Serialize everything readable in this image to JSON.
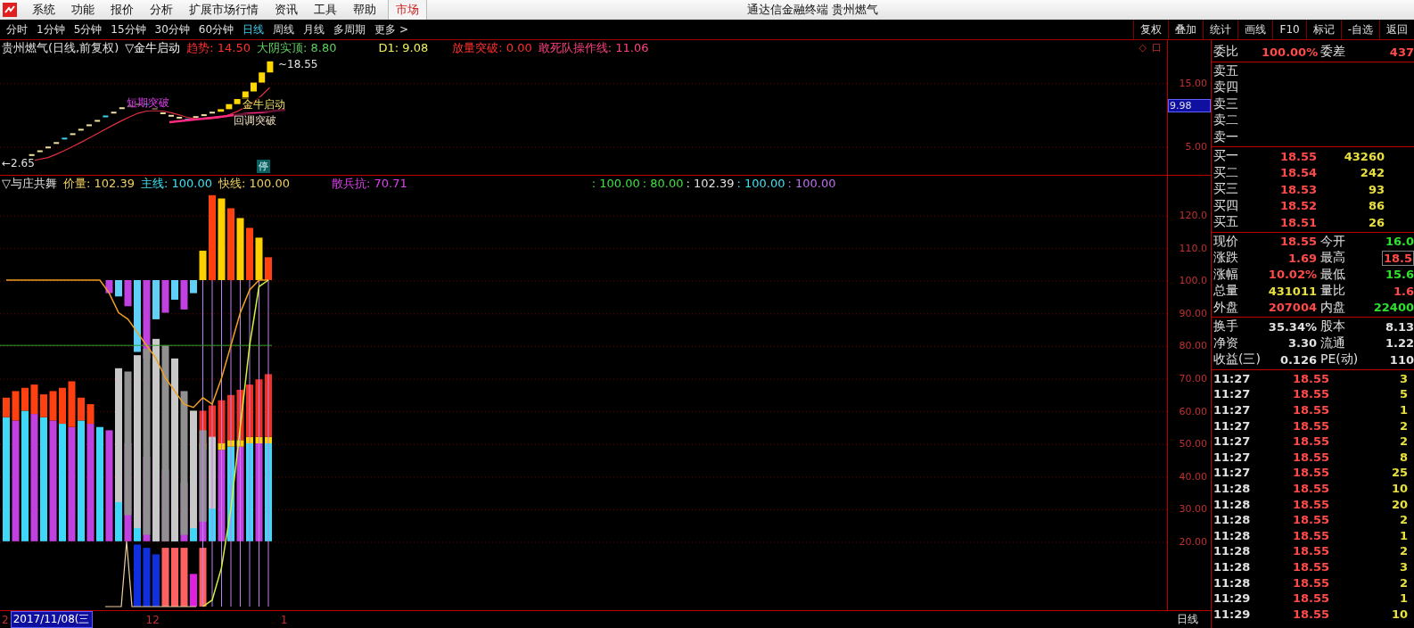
{
  "menu_bar": {
    "items": [
      "系统",
      "功能",
      "报价",
      "分析",
      "扩展市场行情",
      "资讯",
      "工具",
      "帮助"
    ],
    "market_tab": "市场",
    "title": "通达信金融终端 贵州燃气"
  },
  "period_tabs": [
    {
      "label": "分时",
      "selected": false
    },
    {
      "label": "1分钟",
      "selected": false
    },
    {
      "label": "5分钟",
      "selected": false
    },
    {
      "label": "15分钟",
      "selected": false
    },
    {
      "label": "30分钟",
      "selected": false
    },
    {
      "label": "60分钟",
      "selected": false
    },
    {
      "label": "日线",
      "selected": true
    },
    {
      "label": "周线",
      "selected": false
    },
    {
      "label": "月线",
      "selected": false
    },
    {
      "label": "多周期",
      "selected": false
    },
    {
      "label": "更多 >",
      "selected": false
    }
  ],
  "tool_buttons": [
    "复权",
    "叠加",
    "统计",
    "画线",
    "F10",
    "标记",
    "-自选",
    "返回"
  ],
  "price_panel": {
    "header": [
      {
        "text": "贵州燃气(日线,前复权)",
        "color": "#e0e0e0"
      },
      {
        "text": "▽金牛启动",
        "color": "#f4f4f4"
      },
      {
        "text": "趋势: 14.50",
        "color": "#ff3030"
      },
      {
        "text": "大阴实顶: 8.80",
        "color": "#60d060"
      },
      {
        "text": "D1: 9.08",
        "color": "#f0f060"
      },
      {
        "text": "放量突破: 0.00",
        "color": "#ff3030"
      },
      {
        "text": "敢死队操作线: 11.06",
        "color": "#ff4080"
      }
    ],
    "corner_icons": [
      "◇",
      "口"
    ],
    "high_label": "~18.55",
    "low_label": "←2.65",
    "annotations": [
      "短期突破",
      "金牛启动",
      "回调突破"
    ],
    "limit_badge": "停",
    "axis_ticks": [
      "15.00",
      "5.00"
    ],
    "current_tag": "9.98"
  },
  "indicator_panel": {
    "header": [
      {
        "text": "▽与庄共舞",
        "color": "#e0e0e0"
      },
      {
        "text": "价量: 102.39",
        "color": "#f0d060"
      },
      {
        "text": "主线: 100.00",
        "color": "#40e0f0"
      },
      {
        "text": "快线: 100.00",
        "color": "#f0d060"
      },
      {
        "text": "散兵抗: 70.71",
        "color": "#e040f0"
      },
      {
        "text": ": 100.00",
        "color": "#40e040"
      },
      {
        "text": ": 80.00",
        "color": "#40e040"
      },
      {
        "text": ": 102.39",
        "color": "#e0e0e0"
      },
      {
        "text": ": 100.00",
        "color": "#40e0f0"
      },
      {
        "text": ": 100.00",
        "color": "#c070f0"
      }
    ],
    "axis_ticks": [
      "120.0",
      "110.0",
      "100.0",
      "90.00",
      "80.00",
      "70.00",
      "60.00",
      "50.00",
      "40.00",
      "30.00",
      "20.00"
    ]
  },
  "date_bar": {
    "lead": "2",
    "date": "2017/11/08(三",
    "marks": [
      "12",
      "1"
    ],
    "period": "日线"
  },
  "quote_panel": {
    "ratio_row": {
      "label": "委比",
      "value": "100.00%",
      "label2": "委差",
      "value2": "437"
    },
    "asks": [
      "卖五",
      "卖四",
      "卖三",
      "卖二",
      "卖一"
    ],
    "bids": [
      {
        "label": "买一",
        "price": "18.55",
        "volume": "43260"
      },
      {
        "label": "买二",
        "price": "18.54",
        "volume": "242"
      },
      {
        "label": "买三",
        "price": "18.53",
        "volume": "93"
      },
      {
        "label": "买四",
        "price": "18.52",
        "volume": "86"
      },
      {
        "label": "买五",
        "price": "18.51",
        "volume": "26"
      }
    ],
    "stats": [
      {
        "left": {
          "label": "现价",
          "value": "18.55",
          "color": "#ff4a4a"
        },
        "right": {
          "label": "今开",
          "value": "16.0",
          "color": "#30e030",
          "boxed": false
        }
      },
      {
        "left": {
          "label": "涨跌",
          "value": "1.69",
          "color": "#ff4a4a"
        },
        "right": {
          "label": "最高",
          "value": "18.5",
          "color": "#ff4a4a",
          "boxed": true
        }
      },
      {
        "left": {
          "label": "涨幅",
          "value": "10.02%",
          "color": "#ff4a4a"
        },
        "right": {
          "label": "最低",
          "value": "15.6",
          "color": "#30e030",
          "boxed": false
        }
      },
      {
        "left": {
          "label": "总量",
          "value": "431011",
          "color": "#e8e040"
        },
        "right": {
          "label": "量比",
          "value": "1.6",
          "color": "#ff4a4a",
          "boxed": false
        }
      },
      {
        "left": {
          "label": "外盘",
          "value": "207004",
          "color": "#ff4a4a"
        },
        "right": {
          "label": "内盘",
          "value": "22400",
          "color": "#30e030",
          "boxed": false
        }
      }
    ],
    "fundamentals": [
      {
        "label": "换手",
        "value": "35.34%",
        "label2": "股本",
        "value2": "8.13"
      },
      {
        "label": "净资",
        "value": "3.30",
        "label2": "流通",
        "value2": "1.22"
      },
      {
        "label": "收益(三)",
        "value": "0.126",
        "label2": "PE(动)",
        "value2": "110"
      }
    ],
    "ticks": [
      {
        "time": "11:27",
        "price": "18.55",
        "volume": "3"
      },
      {
        "time": "11:27",
        "price": "18.55",
        "volume": "5"
      },
      {
        "time": "11:27",
        "price": "18.55",
        "volume": "1"
      },
      {
        "time": "11:27",
        "price": "18.55",
        "volume": "2"
      },
      {
        "time": "11:27",
        "price": "18.55",
        "volume": "2"
      },
      {
        "time": "11:27",
        "price": "18.55",
        "volume": "8"
      },
      {
        "time": "11:27",
        "price": "18.55",
        "volume": "25"
      },
      {
        "time": "11:28",
        "price": "18.55",
        "volume": "10"
      },
      {
        "time": "11:28",
        "price": "18.55",
        "volume": "20"
      },
      {
        "time": "11:28",
        "price": "18.55",
        "volume": "2"
      },
      {
        "time": "11:28",
        "price": "18.55",
        "volume": "1"
      },
      {
        "time": "11:28",
        "price": "18.55",
        "volume": "2"
      },
      {
        "time": "11:28",
        "price": "18.55",
        "volume": "3"
      },
      {
        "time": "11:28",
        "price": "18.55",
        "volume": "2"
      },
      {
        "time": "11:29",
        "price": "18.55",
        "volume": "1"
      },
      {
        "time": "11:29",
        "price": "18.55",
        "volume": "10"
      }
    ]
  }
}
